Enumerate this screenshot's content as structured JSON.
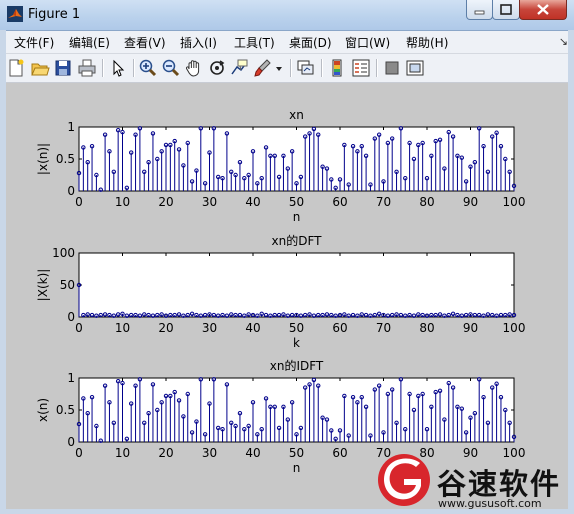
{
  "window": {
    "title": "Figure 1"
  },
  "menus": [
    "文件(F)",
    "编辑(E)",
    "查看(V)",
    "插入(I)",
    "工具(T)",
    "桌面(D)",
    "窗口(W)",
    "帮助(H)"
  ],
  "toolbar_icons": [
    "new-figure-icon",
    "open-file-icon",
    "save-icon",
    "print-icon",
    "pointer-icon",
    "zoom-in-icon",
    "zoom-out-icon",
    "pan-icon",
    "rotate-3d-icon",
    "data-cursor-icon",
    "brush-icon",
    "brush-dropdown-icon",
    "link-plot-icon",
    "colorbar-icon",
    "legend-icon",
    "hide-plot-tools-icon",
    "show-plot-tools-icon"
  ],
  "colors": {
    "stem": "#00008b",
    "axes_bg": "#ffffff",
    "figure_bg": "#c8c8c8",
    "watermark_red": "#d8262c"
  },
  "watermark": {
    "text": "谷速软件",
    "url": "www.gususoft.com"
  },
  "chart_data": [
    {
      "type": "stem",
      "title": "xn",
      "xlabel": "n",
      "ylabel": "|x(n)|",
      "xlim": [
        0,
        100
      ],
      "ylim": [
        0,
        1
      ],
      "xticks": [
        "0",
        "10",
        "20",
        "30",
        "40",
        "50",
        "60",
        "70",
        "80",
        "90",
        "100"
      ],
      "yticks": [
        "0",
        "0.5",
        "1"
      ],
      "values": [
        0.28,
        0.68,
        0.45,
        0.7,
        0.25,
        0.02,
        0.88,
        0.62,
        0.3,
        0.95,
        0.92,
        0.05,
        0.6,
        0.88,
        0.98,
        0.3,
        0.45,
        0.9,
        0.5,
        0.62,
        0.72,
        0.72,
        0.78,
        0.65,
        0.4,
        0.75,
        0.15,
        0.32,
        0.98,
        0.12,
        0.6,
        0.98,
        0.22,
        0.2,
        0.9,
        0.3,
        0.25,
        0.45,
        0.2,
        0.25,
        0.62,
        0.12,
        0.2,
        0.68,
        0.55,
        0.55,
        0.22,
        0.55,
        0.35,
        0.62,
        0.12,
        0.22,
        0.85,
        0.9,
        0.97,
        0.88,
        0.38,
        0.35,
        0.18,
        0.05,
        0.18,
        0.72,
        0.1,
        0.7,
        0.62,
        0.7,
        0.55,
        0.1,
        0.82,
        0.88,
        0.15,
        0.75,
        0.82,
        0.3,
        0.98,
        0.2,
        0.75,
        0.5,
        0.72,
        0.75,
        0.2,
        0.55,
        0.78,
        0.8,
        0.35,
        0.92,
        0.85,
        0.55,
        0.52,
        0.15,
        0.38,
        0.45,
        0.98,
        0.7,
        0.3,
        0.85,
        0.91,
        0.7,
        0.5,
        0.3,
        0.08
      ]
    },
    {
      "type": "stem",
      "title": "xn的DFT",
      "xlabel": "k",
      "ylabel": "|X(k)|",
      "xlim": [
        0,
        100
      ],
      "ylim": [
        0,
        100
      ],
      "xticks": [
        "0",
        "10",
        "20",
        "30",
        "40",
        "50",
        "60",
        "70",
        "80",
        "90",
        "100"
      ],
      "yticks": [
        "0",
        "50",
        "100"
      ],
      "values": [
        50,
        3,
        4,
        3,
        2,
        3,
        4,
        3,
        2,
        4,
        5,
        2,
        3,
        3,
        2,
        4,
        3,
        2,
        3,
        4,
        2,
        3,
        3,
        4,
        2,
        3,
        5,
        3,
        2,
        3,
        4,
        3,
        2,
        3,
        2,
        4,
        3,
        3,
        2,
        4,
        3,
        2,
        5,
        3,
        2,
        3,
        3,
        4,
        2,
        3,
        3,
        2,
        3,
        4,
        2,
        3,
        3,
        4,
        3,
        2,
        3,
        4,
        2,
        3,
        2,
        4,
        3,
        2,
        3,
        5,
        3,
        2,
        3,
        4,
        3,
        2,
        3,
        2,
        4,
        3,
        2,
        3,
        3,
        4,
        2,
        3,
        5,
        3,
        2,
        3,
        4,
        3,
        3,
        2,
        4,
        3,
        2,
        3,
        3,
        4,
        3
      ]
    },
    {
      "type": "stem",
      "title": "xn的IDFT",
      "xlabel": "n",
      "ylabel": "x(n)",
      "xlim": [
        0,
        100
      ],
      "ylim": [
        0,
        1
      ],
      "xticks": [
        "0",
        "10",
        "20",
        "30",
        "40",
        "50",
        "60",
        "70",
        "80",
        "90",
        "100"
      ],
      "yticks": [
        "0",
        "0.5",
        "1"
      ],
      "values": [
        0.28,
        0.68,
        0.45,
        0.7,
        0.25,
        0.02,
        0.88,
        0.62,
        0.3,
        0.95,
        0.92,
        0.05,
        0.6,
        0.88,
        0.98,
        0.3,
        0.45,
        0.9,
        0.5,
        0.62,
        0.72,
        0.72,
        0.78,
        0.65,
        0.4,
        0.75,
        0.15,
        0.32,
        0.98,
        0.12,
        0.6,
        0.98,
        0.22,
        0.2,
        0.9,
        0.3,
        0.25,
        0.45,
        0.2,
        0.25,
        0.62,
        0.12,
        0.2,
        0.68,
        0.55,
        0.55,
        0.22,
        0.55,
        0.35,
        0.62,
        0.12,
        0.22,
        0.85,
        0.9,
        0.97,
        0.88,
        0.38,
        0.35,
        0.18,
        0.05,
        0.18,
        0.72,
        0.1,
        0.7,
        0.62,
        0.7,
        0.55,
        0.1,
        0.82,
        0.88,
        0.15,
        0.75,
        0.82,
        0.3,
        0.98,
        0.2,
        0.75,
        0.5,
        0.72,
        0.75,
        0.2,
        0.55,
        0.78,
        0.8,
        0.35,
        0.92,
        0.85,
        0.55,
        0.52,
        0.15,
        0.38,
        0.45,
        0.98,
        0.7,
        0.3,
        0.85,
        0.91,
        0.7,
        0.5,
        0.3,
        0.08
      ]
    }
  ]
}
